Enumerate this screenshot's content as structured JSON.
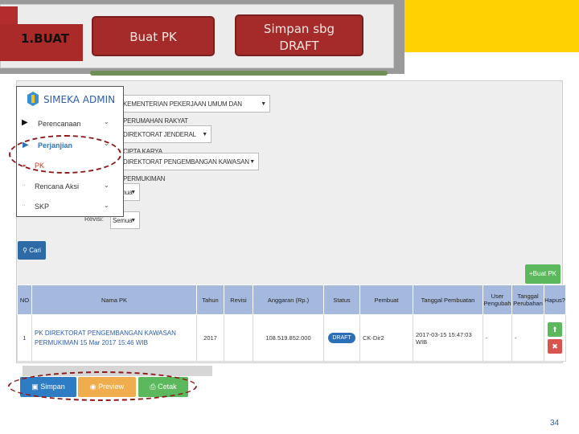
{
  "banner": {
    "step_label": "1.BUAT",
    "buat_pk_label": "Buat PK",
    "simpan_draft_line1": "Simpan sbg",
    "simpan_draft_line2": "DRAFT"
  },
  "app": {
    "title": "SIMEKA ADMIN"
  },
  "filters": {
    "kementerian": "KEMENTERIAN PEKERJAAN UMUM DAN PERUMAHAN RAKYAT",
    "direktorat_jenderal": "DIREKTORAT JENDERAL CIPTA KARYA",
    "direktorat": "DIREKTORAT PENGEMBANGAN KAWASAN PERMUKIMAN",
    "tahun": "Semua",
    "revisi_label": "Revisi:",
    "revisi": "Semua"
  },
  "menu": {
    "items": [
      {
        "label": "Perencanaan",
        "state": "collapsed"
      },
      {
        "label": "Perjanjian",
        "state": "active"
      },
      {
        "label": "PK",
        "state": "selected"
      },
      {
        "label": "Rencana Aksi",
        "state": "collapsed"
      },
      {
        "label": "SKP",
        "state": "collapsed"
      }
    ]
  },
  "actions": {
    "cari_label": "Cari",
    "buat_pk_label": "Buat PK"
  },
  "table": {
    "headers": [
      "NO",
      "Nama PK",
      "Tahun",
      "Revisi",
      "Anggaran (Rp.)",
      "Status",
      "Pembuat",
      "Tanggal Pembuatan",
      "User Pengubah",
      "Tanggal Perubahan",
      "Hapus?"
    ],
    "rows": [
      {
        "no": "1",
        "nama_pk": "PK DIREKTORAT PENGEMBANGAN KAWASAN PERMUKIMAN 15 Mar 2017 15:46 WIB",
        "tahun": "2017",
        "revisi": "",
        "anggaran": "108.519.852.000",
        "status": "DRAFT",
        "pembuat": "CK-Dir2",
        "tanggal_pembuatan": "2017-03-15 15:47:03 WIB",
        "user_pengubah": "-",
        "tanggal_perubahan": "-"
      }
    ]
  },
  "bottom_buttons": {
    "simpan": "Simpan",
    "preview": "Preview",
    "cetak": "Cetak"
  },
  "page_number": "34",
  "colors": {
    "accent_red": "#a52a2a",
    "banner_yellow": "#ffd200",
    "table_header": "#a5b9de",
    "primary_blue": "#2e7dc4",
    "success_green": "#5cb85c",
    "warning_orange": "#f0ad4e"
  }
}
